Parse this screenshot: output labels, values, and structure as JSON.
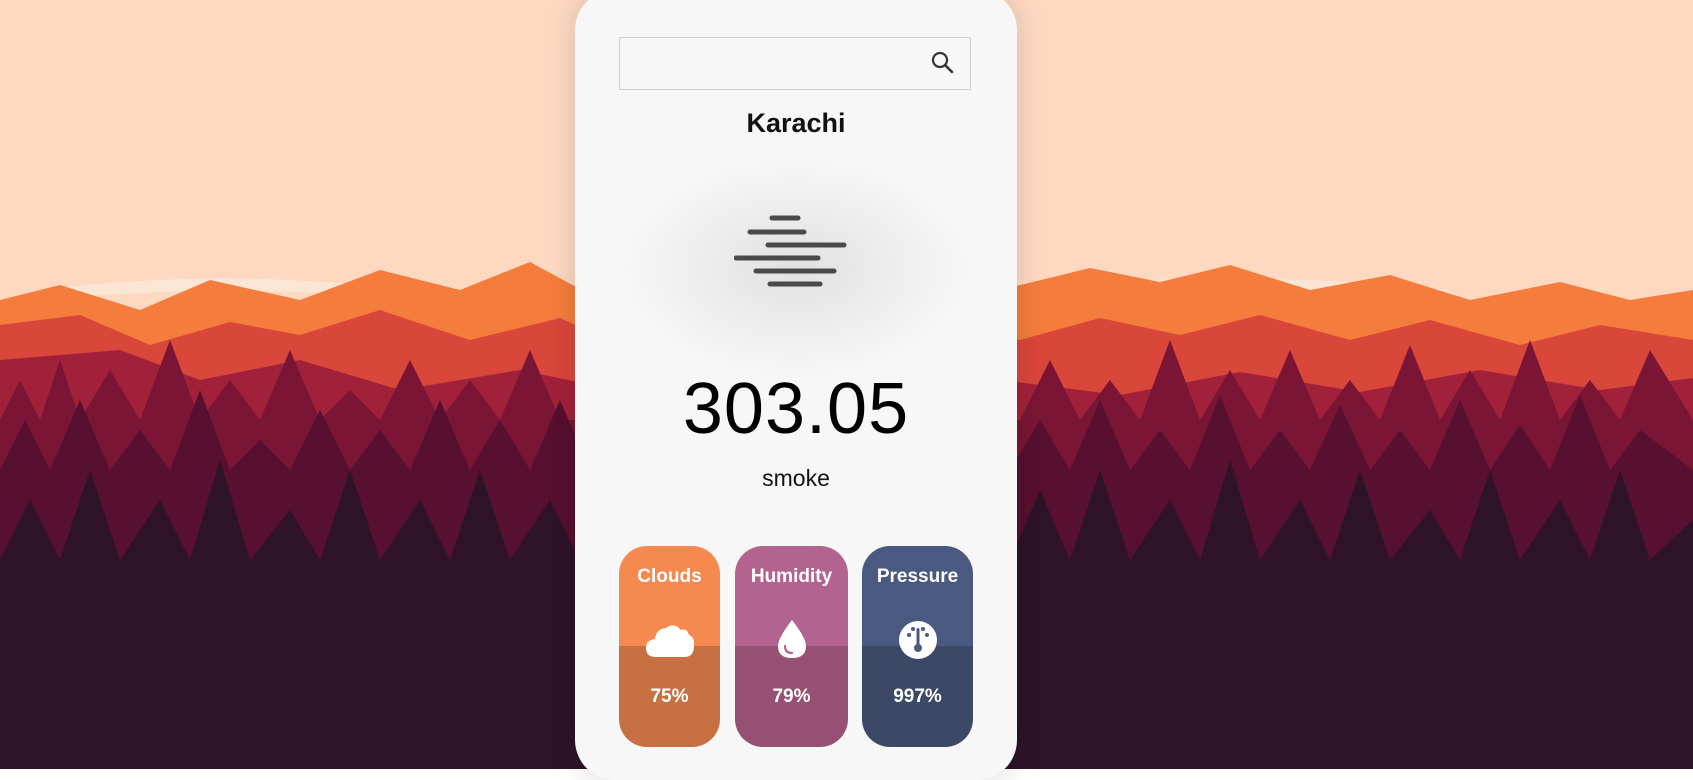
{
  "search": {
    "value": "",
    "placeholder": "",
    "button_icon": "search-icon"
  },
  "weather": {
    "city": "Karachi",
    "temperature": "303.05",
    "description": "smoke",
    "icon": "smoke-haze-icon"
  },
  "stats": {
    "clouds": {
      "label": "Clouds",
      "value": "75%",
      "icon": "cloud-icon",
      "color_top": "#f6894f",
      "color_bottom": "#c77041"
    },
    "humidity": {
      "label": "Humidity",
      "value": "79%",
      "icon": "water-drop-icon",
      "color_top": "#b3638f",
      "color_bottom": "#955073"
    },
    "pressure": {
      "label": "Pressure",
      "value": "997%",
      "icon": "gauge-icon",
      "color_top": "#49597f",
      "color_bottom": "#3b4866"
    }
  },
  "background": {
    "theme": "forest-mountains-sunset",
    "sky": "#fdd9c2"
  }
}
